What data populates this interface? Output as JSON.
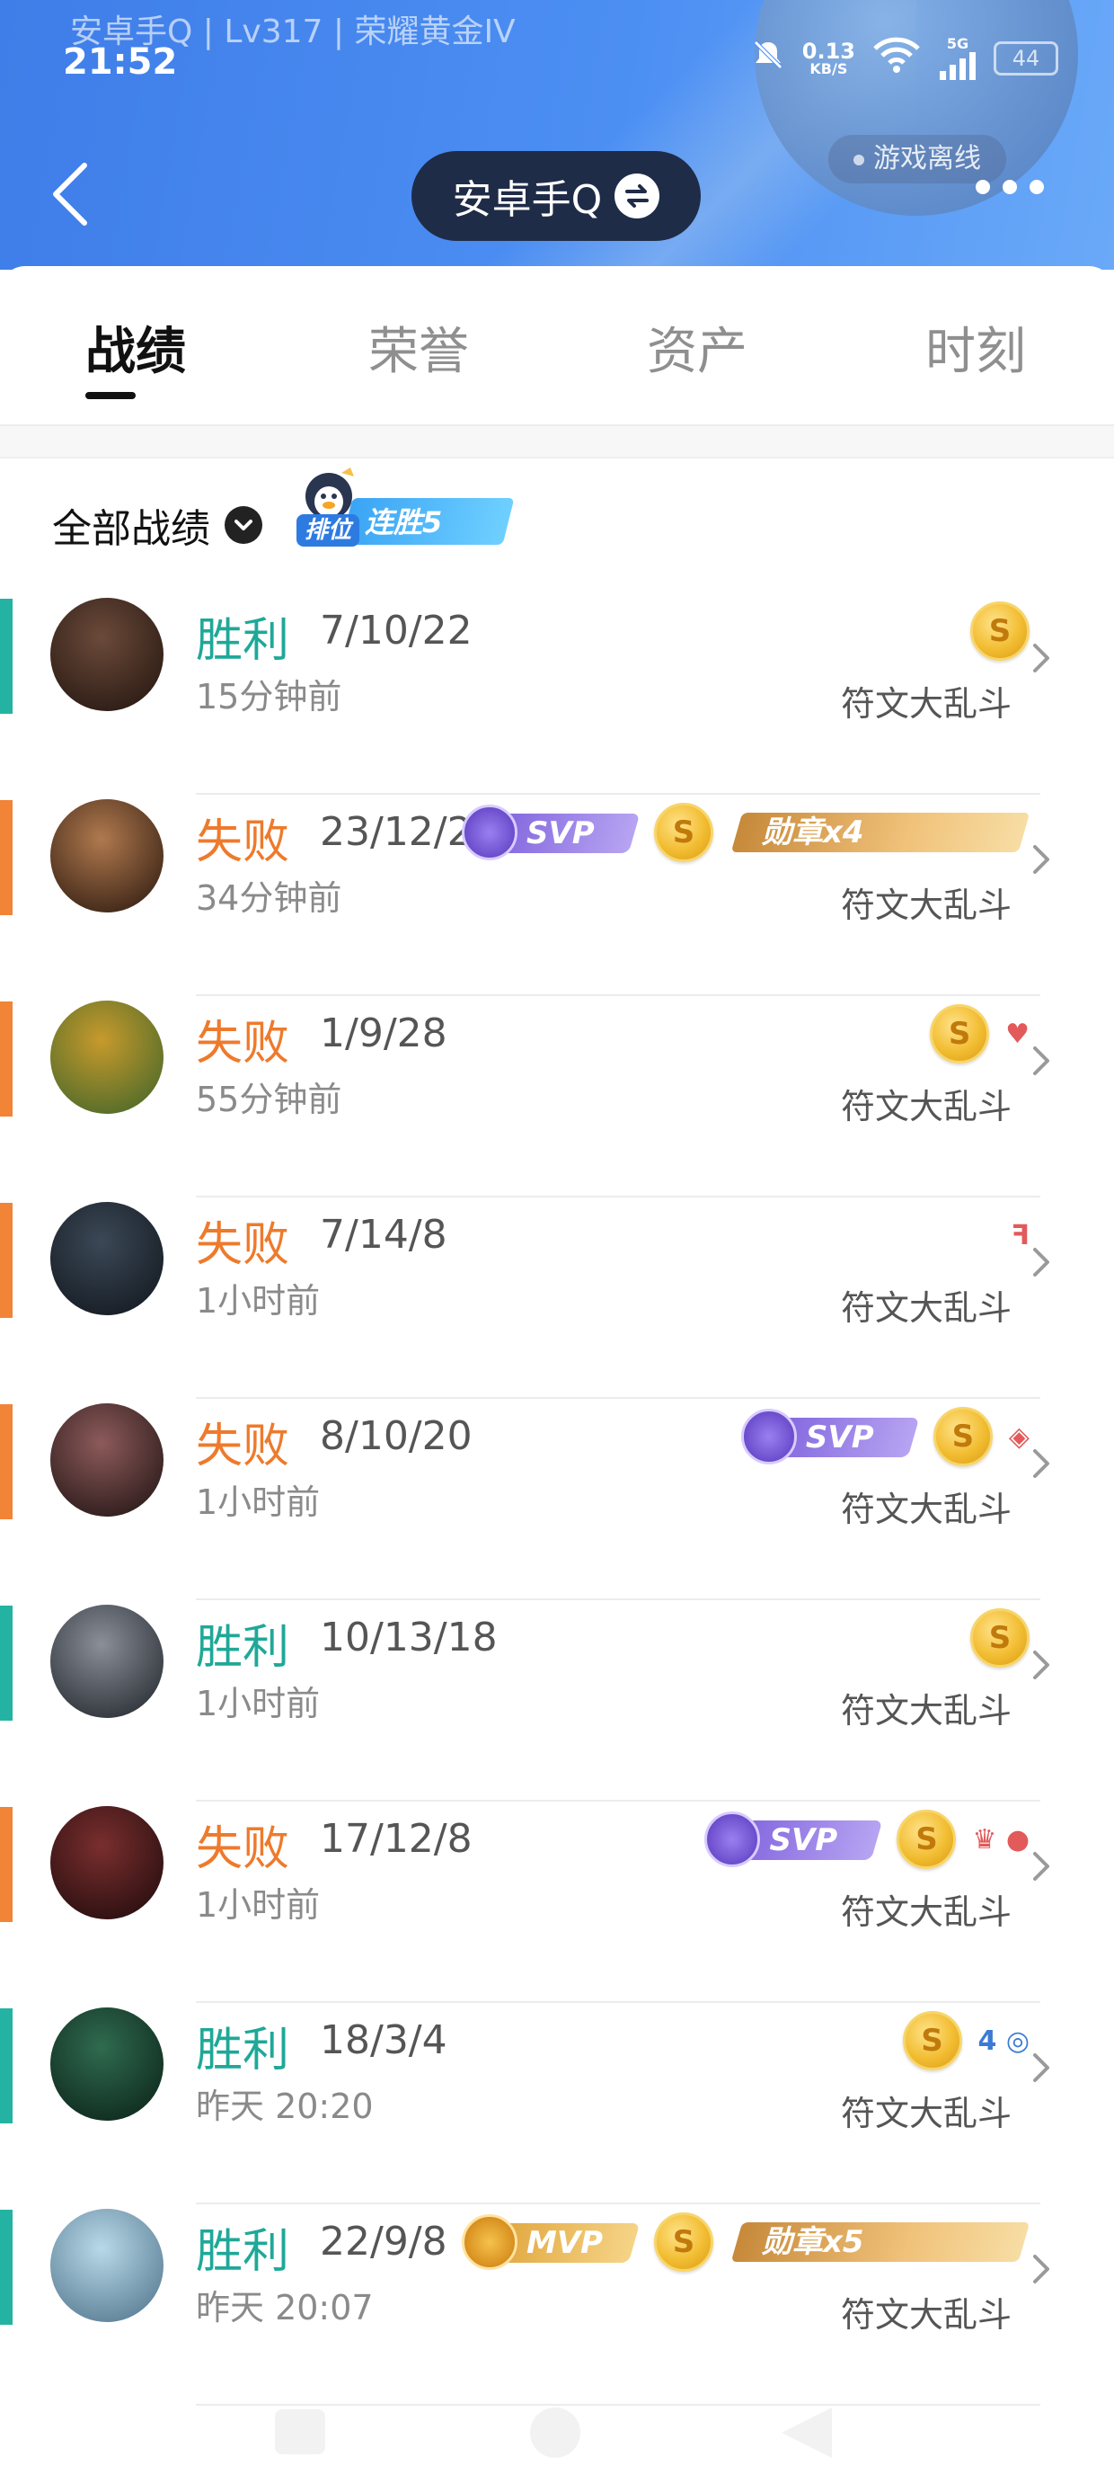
{
  "status_bar": {
    "account_line": "安卓手Q | Lv317 | 荣耀黄金IV",
    "time": "21:52",
    "net_speed": "0.13",
    "net_unit": "KB/S",
    "signal_label": "5G",
    "battery": "44"
  },
  "header": {
    "offline_label": "游戏离线",
    "account_name": "安卓手Q"
  },
  "tabs": [
    {
      "label": "战绩",
      "active": true
    },
    {
      "label": "荣誉",
      "active": false
    },
    {
      "label": "资产",
      "active": false
    },
    {
      "label": "时刻",
      "active": false
    }
  ],
  "filter": {
    "label": "全部战绩",
    "streak_rank": "排位",
    "streak_label": "连胜5"
  },
  "matches": [
    {
      "result": "胜利",
      "outcome": "win",
      "kda": "7/10/22",
      "time": "15分钟前",
      "mode": "符文大乱斗",
      "badges": {
        "coin": "S"
      }
    },
    {
      "result": "失败",
      "outcome": "loss",
      "kda": "23/12/2",
      "time": "34分钟前",
      "mode": "符文大乱斗",
      "badges": {
        "svp": "SVP",
        "coin": "S",
        "medal": "勋章x4"
      }
    },
    {
      "result": "失败",
      "outcome": "loss",
      "kda": "1/9/28",
      "time": "55分钟前",
      "mode": "符文大乱斗",
      "badges": {
        "coin": "S",
        "mini": "♥"
      }
    },
    {
      "result": "失败",
      "outcome": "loss",
      "kda": "7/14/8",
      "time": "1小时前",
      "mode": "符文大乱斗",
      "badges": {
        "mini": "ꟻ"
      }
    },
    {
      "result": "失败",
      "outcome": "loss",
      "kda": "8/10/20",
      "time": "1小时前",
      "mode": "符文大乱斗",
      "badges": {
        "svp": "SVP",
        "coin": "S",
        "mini": "◈"
      }
    },
    {
      "result": "胜利",
      "outcome": "win",
      "kda": "10/13/18",
      "time": "1小时前",
      "mode": "符文大乱斗",
      "badges": {
        "coin": "S"
      }
    },
    {
      "result": "失败",
      "outcome": "loss",
      "kda": "17/12/8",
      "time": "1小时前",
      "mode": "符文大乱斗",
      "badges": {
        "svp": "SVP",
        "coin": "S",
        "mini": "♛ ●"
      }
    },
    {
      "result": "胜利",
      "outcome": "win",
      "kda": "18/3/4",
      "time": "昨天 20:20",
      "mode": "符文大乱斗",
      "badges": {
        "coin": "S",
        "mini": "4 ◎"
      }
    },
    {
      "result": "胜利",
      "outcome": "win",
      "kda": "22/9/8",
      "time": "昨天 20:07",
      "mode": "符文大乱斗",
      "badges": {
        "mvp": "MVP",
        "coin": "S",
        "medal": "勋章x5"
      }
    }
  ],
  "colors": {
    "win": "#1fa898",
    "loss": "#ee7a2c",
    "header_blue": "#4c8ff3"
  }
}
